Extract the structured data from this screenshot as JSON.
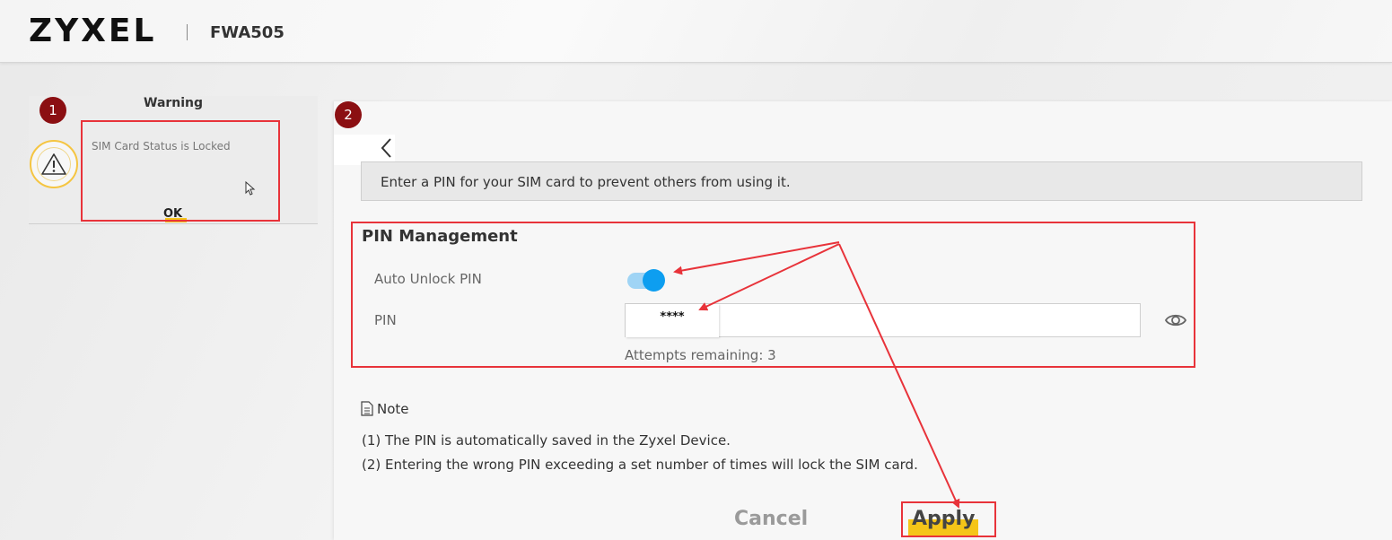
{
  "header": {
    "brand": "ZYXEL",
    "model": "FWA505"
  },
  "warning_dialog": {
    "title": "Warning",
    "message": "SIM Card Status is Locked",
    "ok_label": "OK",
    "marker": "1"
  },
  "pin_page": {
    "marker": "2",
    "info_text": "Enter a PIN for your SIM card to prevent others from using it.",
    "section_title": "PIN Management",
    "auto_unlock_label": "Auto Unlock PIN",
    "auto_unlock_enabled": true,
    "pin_label": "PIN",
    "pin_value": "****",
    "attempts_text": "Attempts remaining: 3",
    "note_title": "Note",
    "notes": [
      "(1) The PIN is automatically saved in the Zyxel Device.",
      "(2) Entering the wrong PIN exceeding a set number of times will lock the SIM card."
    ],
    "cancel_label": "Cancel",
    "apply_label": "Apply"
  },
  "colors": {
    "accent_blue": "#0d9ef0",
    "highlight_yellow": "#f5c518",
    "annotation_red": "#e8333a",
    "marker_red": "#8b0f12"
  }
}
